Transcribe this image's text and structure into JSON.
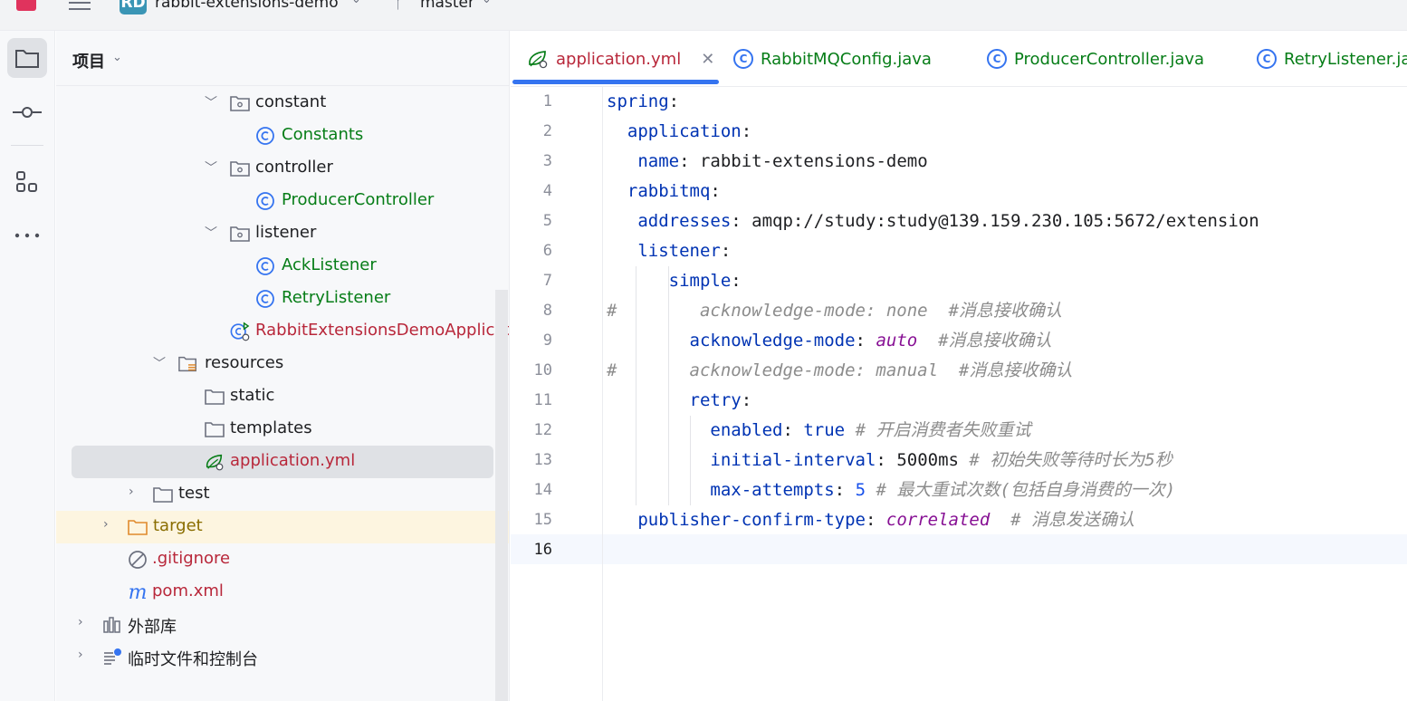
{
  "topbar": {
    "project_badge": "RD",
    "project_name": "rabbit-extensions-demo",
    "branch": "master"
  },
  "panel": {
    "title": "项目",
    "tree": [
      {
        "label": "constant",
        "kind": "folder-package",
        "expanded": true
      },
      {
        "label": "Constants",
        "kind": "class"
      },
      {
        "label": "controller",
        "kind": "folder-package",
        "expanded": true
      },
      {
        "label": "ProducerController",
        "kind": "class"
      },
      {
        "label": "listener",
        "kind": "folder-package",
        "expanded": true
      },
      {
        "label": "AckListener",
        "kind": "class"
      },
      {
        "label": "RetryListener",
        "kind": "class"
      },
      {
        "label": "RabbitExtensionsDemoApplicatio",
        "kind": "spring-boot-app"
      },
      {
        "label": "resources",
        "kind": "folder-resources",
        "expanded": true
      },
      {
        "label": "static",
        "kind": "folder"
      },
      {
        "label": "templates",
        "kind": "folder"
      },
      {
        "label": "application.yml",
        "kind": "yaml",
        "selected": true
      },
      {
        "label": "test",
        "kind": "folder",
        "expanded": false
      },
      {
        "label": "target",
        "kind": "folder-excluded",
        "expanded": false
      },
      {
        "label": ".gitignore",
        "kind": "ignore-file"
      },
      {
        "label": "pom.xml",
        "kind": "maven"
      },
      {
        "label": "外部库",
        "kind": "library",
        "expanded": false
      },
      {
        "label": "临时文件和控制台",
        "kind": "scratches",
        "expanded": false
      }
    ]
  },
  "tabs": [
    {
      "label": "application.yml",
      "active": true
    },
    {
      "label": "RabbitMQConfig.java"
    },
    {
      "label": "ProducerController.java"
    },
    {
      "label": "RetryListener.java"
    }
  ],
  "editor": {
    "line_numbers": [
      "1",
      "2",
      "3",
      "4",
      "5",
      "6",
      "7",
      "8",
      "9",
      "10",
      "11",
      "12",
      "13",
      "14",
      "15",
      "16"
    ],
    "current_line": "16",
    "lines": {
      "l1_key": "spring",
      "l2_key": "application",
      "l3_key": "name",
      "l3_val": "rabbit-extensions-demo",
      "l4_key": "rabbitmq",
      "l5_key": "addresses",
      "l5_val": "amqp://study:study@139.159.230.105:5672/extension",
      "l6_key": "listener",
      "l7_key": "simple",
      "l8_text": "#        acknowledge-mode: none  #消息接收确认",
      "l9_key": "acknowledge-mode",
      "l9_val": "auto",
      "l9_comment": "#消息接收确认",
      "l10_text": "#       acknowledge-mode: manual  #消息接收确认",
      "l11_key": "retry",
      "l12_key": "enabled",
      "l12_val": "true",
      "l12_comment": "# 开启消费者失败重试",
      "l13_key": "initial-interval",
      "l13_val": "5000ms",
      "l13_comment": "# 初始失败等待时长为5秒",
      "l14_key": "max-attempts",
      "l14_val": "5",
      "l14_comment": "# 最大重试次数(包括自身消费的一次)",
      "l15_key": "publisher-confirm-type",
      "l15_val": "correlated",
      "l15_comment": "# 消息发送确认"
    }
  }
}
